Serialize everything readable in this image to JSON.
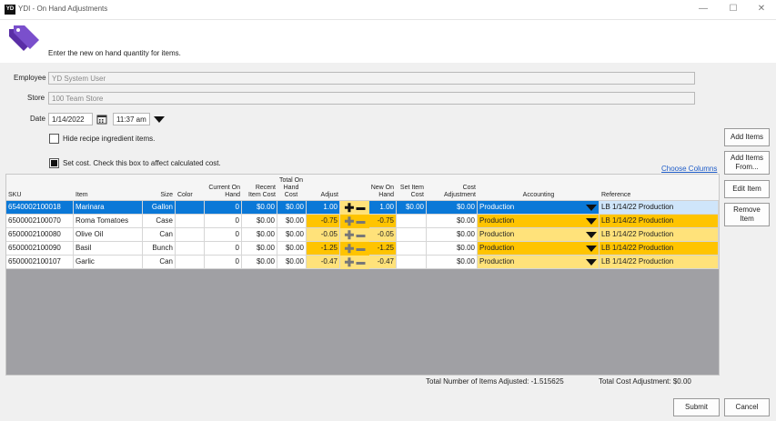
{
  "window": {
    "title": "YDI - On Hand Adjustments",
    "logo_text": "YD",
    "minimize": "—",
    "maximize": "☐",
    "close": "✕"
  },
  "banner": {
    "icon": "price-tags-icon",
    "instruction": "Enter the new on hand quantity for items."
  },
  "form": {
    "employee_label": "Employee",
    "employee_value": "YD System User",
    "store_label": "Store",
    "store_value": "100 Team Store",
    "date_label": "Date",
    "date_value": "1/14/2022",
    "time_value": "11:37 am",
    "hide_recipe_label": "Hide recipe ingredient items.",
    "hide_recipe_checked": false,
    "set_cost_label": "Set cost. Check this box to affect calculated cost.",
    "set_cost_checked": true,
    "choose_columns": "Choose Columns"
  },
  "side_buttons": {
    "add_items": "Add Items",
    "add_items_from": "Add Items From...",
    "edit_item": "Edit Item",
    "remove_item": "Remove Item"
  },
  "table": {
    "headers": {
      "sku": "SKU",
      "item": "Item",
      "size": "Size",
      "color": "Color",
      "current_on_hand": "Current On Hand",
      "recent_item_cost": "Recent Item Cost",
      "total_on_hand_cost": "Total On Hand Cost",
      "adjust": "Adjust",
      "new_on_hand": "New On Hand",
      "set_item_cost": "Set Item Cost",
      "cost_adjustment": "Cost Adjustment",
      "accounting": "Accounting",
      "reference": "Reference"
    },
    "plus": "✚",
    "minus": "▬",
    "rows": [
      {
        "sku": "6540002100018",
        "item": "Marinara",
        "size": "Gallon",
        "color": "",
        "current_on_hand": "0",
        "recent_item_cost": "$0.00",
        "total_on_hand_cost": "$0.00",
        "adjust": "1.00",
        "new_on_hand": "1.00",
        "set_item_cost": "$0.00",
        "cost_adjustment": "$0.00",
        "accounting": "Production",
        "reference": "LB 1/14/22 Production"
      },
      {
        "sku": "6500002100070",
        "item": "Roma Tomatoes",
        "size": "Case",
        "color": "",
        "current_on_hand": "0",
        "recent_item_cost": "$0.00",
        "total_on_hand_cost": "$0.00",
        "adjust": "-0.75",
        "new_on_hand": "-0.75",
        "set_item_cost": "",
        "cost_adjustment": "$0.00",
        "accounting": "Production",
        "reference": "LB 1/14/22 Production"
      },
      {
        "sku": "6500002100080",
        "item": "Olive Oil",
        "size": "Can",
        "color": "",
        "current_on_hand": "0",
        "recent_item_cost": "$0.00",
        "total_on_hand_cost": "$0.00",
        "adjust": "-0.05",
        "new_on_hand": "-0.05",
        "set_item_cost": "",
        "cost_adjustment": "$0.00",
        "accounting": "Production",
        "reference": "LB 1/14/22 Production"
      },
      {
        "sku": "6500002100090",
        "item": "Basil",
        "size": "Bunch",
        "color": "",
        "current_on_hand": "0",
        "recent_item_cost": "$0.00",
        "total_on_hand_cost": "$0.00",
        "adjust": "-1.25",
        "new_on_hand": "-1.25",
        "set_item_cost": "",
        "cost_adjustment": "$0.00",
        "accounting": "Production",
        "reference": "LB 1/14/22 Production"
      },
      {
        "sku": "6500002100107",
        "item": "Garlic",
        "size": "Can",
        "color": "",
        "current_on_hand": "0",
        "recent_item_cost": "$0.00",
        "total_on_hand_cost": "$0.00",
        "adjust": "-0.47",
        "new_on_hand": "-0.47",
        "set_item_cost": "",
        "cost_adjustment": "$0.00",
        "accounting": "Production",
        "reference": "LB 1/14/22 Production"
      }
    ]
  },
  "totals": {
    "items_adjusted": "Total Number of Items Adjusted: -1.515625",
    "cost_adjustment": "Total Cost Adjustment: $0.00"
  },
  "footer": {
    "submit": "Submit",
    "cancel": "Cancel"
  },
  "colors": {
    "accent": "#6b3fb6",
    "selected_row": "#0a78d7",
    "editable_yellow": "#ffe27a",
    "editable_orange": "#ffc400",
    "grid_background": "#a0a0a4"
  }
}
